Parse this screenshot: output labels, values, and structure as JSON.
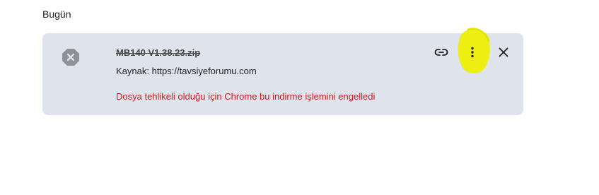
{
  "section": {
    "title": "Bugün"
  },
  "download_item": {
    "file_name": "MB140 V1.38.23.zip",
    "source_text": "Kaynak: https://tavsiyeforumu.com",
    "warning": "Dosya tehlikeli olduğu için Chrome bu indirme işlemini engelledi",
    "status_icon": "blocked-x-icon",
    "actions": {
      "copy_link_icon": "link-icon",
      "more_icon": "more-vertical-icon",
      "close_icon": "close-icon"
    },
    "annotation": "yellow-highlight-circle"
  },
  "colors": {
    "card_background": "#dfe3eb",
    "warning_text": "#c5221f",
    "highlight": "#eef000",
    "icon_gray": "#8e9196"
  }
}
